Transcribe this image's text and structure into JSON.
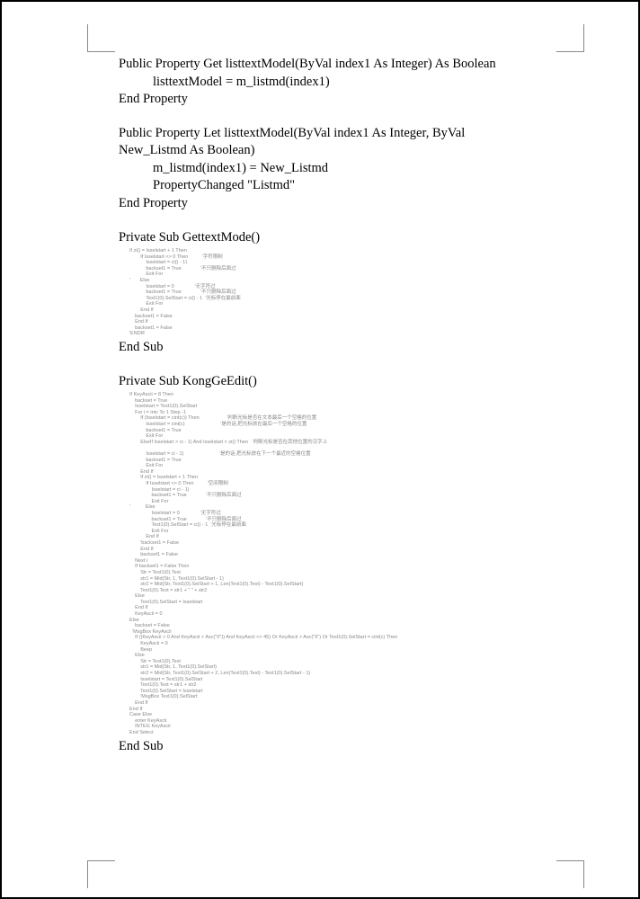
{
  "block1": {
    "line1": "Public Property Get listtextModel(ByVal index1 As Integer) As Boolean",
    "line2": "listtextModel = m_listmd(index1)",
    "line3": "End Property"
  },
  "block2": {
    "line1": "Public Property Let listtextModel(ByVal index1 As Integer, ByVal",
    "line2": "New_Listmd As Boolean)",
    "line3": "m_listmd(index1) = New_Listmd",
    "line4": "PropertyChanged \"Listmd\"",
    "line5": "End Property"
  },
  "block3": {
    "line1": "Private Sub GettextMode()",
    "code": "If zi() = Isselstart + 1 Then\n        If Isselstart <> 0 Then          '字符限制\n            Isselstart = ci() - 1)\n            backset1 = True              '不只删除后面过\n            Exit For\n'       Else\n            Isselstart = 0               '无字符过\n            backset1 = True              '不只删除后面过\n            Text1(0).SelStart = ci() - 1  '光标停在最前面\n            Exit For\n        End If\n    backset1 = False\n    End If\n    backset1 = False\n'ENDIF",
    "line3": "End Sub"
  },
  "block4": {
    "line1": "Private Sub KongGeEdit()",
    "code": "If KeyAscii = 8 Then\n    backset = True\n    Isselstart = Text1(0).SelStart\n    For i = intc To 1 Step -1\n        If (Isselstart = cint(c)) Then                    '判断光标是否在文本最后一个空格的位置\n            Isselstart = cint(c)                          '是的话,把光标放在最后一个空格的位置\n            backset1 = True\n            Exit For\n        ElseIf Isselstart > ci - 1) And Isselstart < zi() Then   '判断光标是否在其他位置的汉字上\n\n            Isselstart = ci - 1)                          '是的话,把光标放在下一个最近的空格位置\n            backset1 = True\n            Exit For\n        End If\n        If zi() = Isselstart + 1 Then\n            If Isselstart <> 0 Then          '空间限制\n                Isselstart = ci - 1)\n                backset1 = True              '不只删除后面过\n                Exit For\n'           Else\n                Isselstart = 0               '无字符过\n                backset1 = True              '不只删除后面过\n                Text1(0).SelStart = ci() - 1  '光标停在最前面\n                Exit For\n            End If\n        'backset1 = False\n        End If\n        backset1 = False\n    Next i\n    If backset1 = False Then\n        Str = Text1(0).Text\n        str1 = Mid(Str, 1, Text1(0).SelStart - 1)\n        str2 = Mid(Str, Text1(0).SelStart + 1, Len(Text1(0).Text) - Text1(0).SelStart)\n        Text1(0).Text = str1 + \" \" + str2\n    Else\n        Text1(0).SelStart = Isselstart\n    End If\n    KeyAscii = 0\nElse\n    backset = False\n  'MsgBox KeyAscii\n    If ((KeyAscii > 0 And KeyAscii < Asc(\"0\")) And KeyAscii <> 45) Or KeyAscii > Asc(\"9\") Or Text1(0).SelStart = cint(c) Then\n        KeyAscii = 0\n        Beep\n    Else\n        Str = Text1(0).Text\n        str1 = Mid(Str, 1, Text1(0).SelStart)\n        str2 = Mid(Str, Text1(0).SelStart + 2, Len(Text1(0).Text) - Text1(0).SelStart - 1)\n        Isselstart = Text1(0).SelStart\n        Text1(0).Text = str1 + str2\n        Text1(0).SelStart = Isselstart\n        'MsgBox Text1(0).SelStart\n    End If\nEnd If\nCase Else\n    enter KeyAscii\n    INTEG KeyAscii\nEnd Select",
    "line3": "End Sub"
  }
}
